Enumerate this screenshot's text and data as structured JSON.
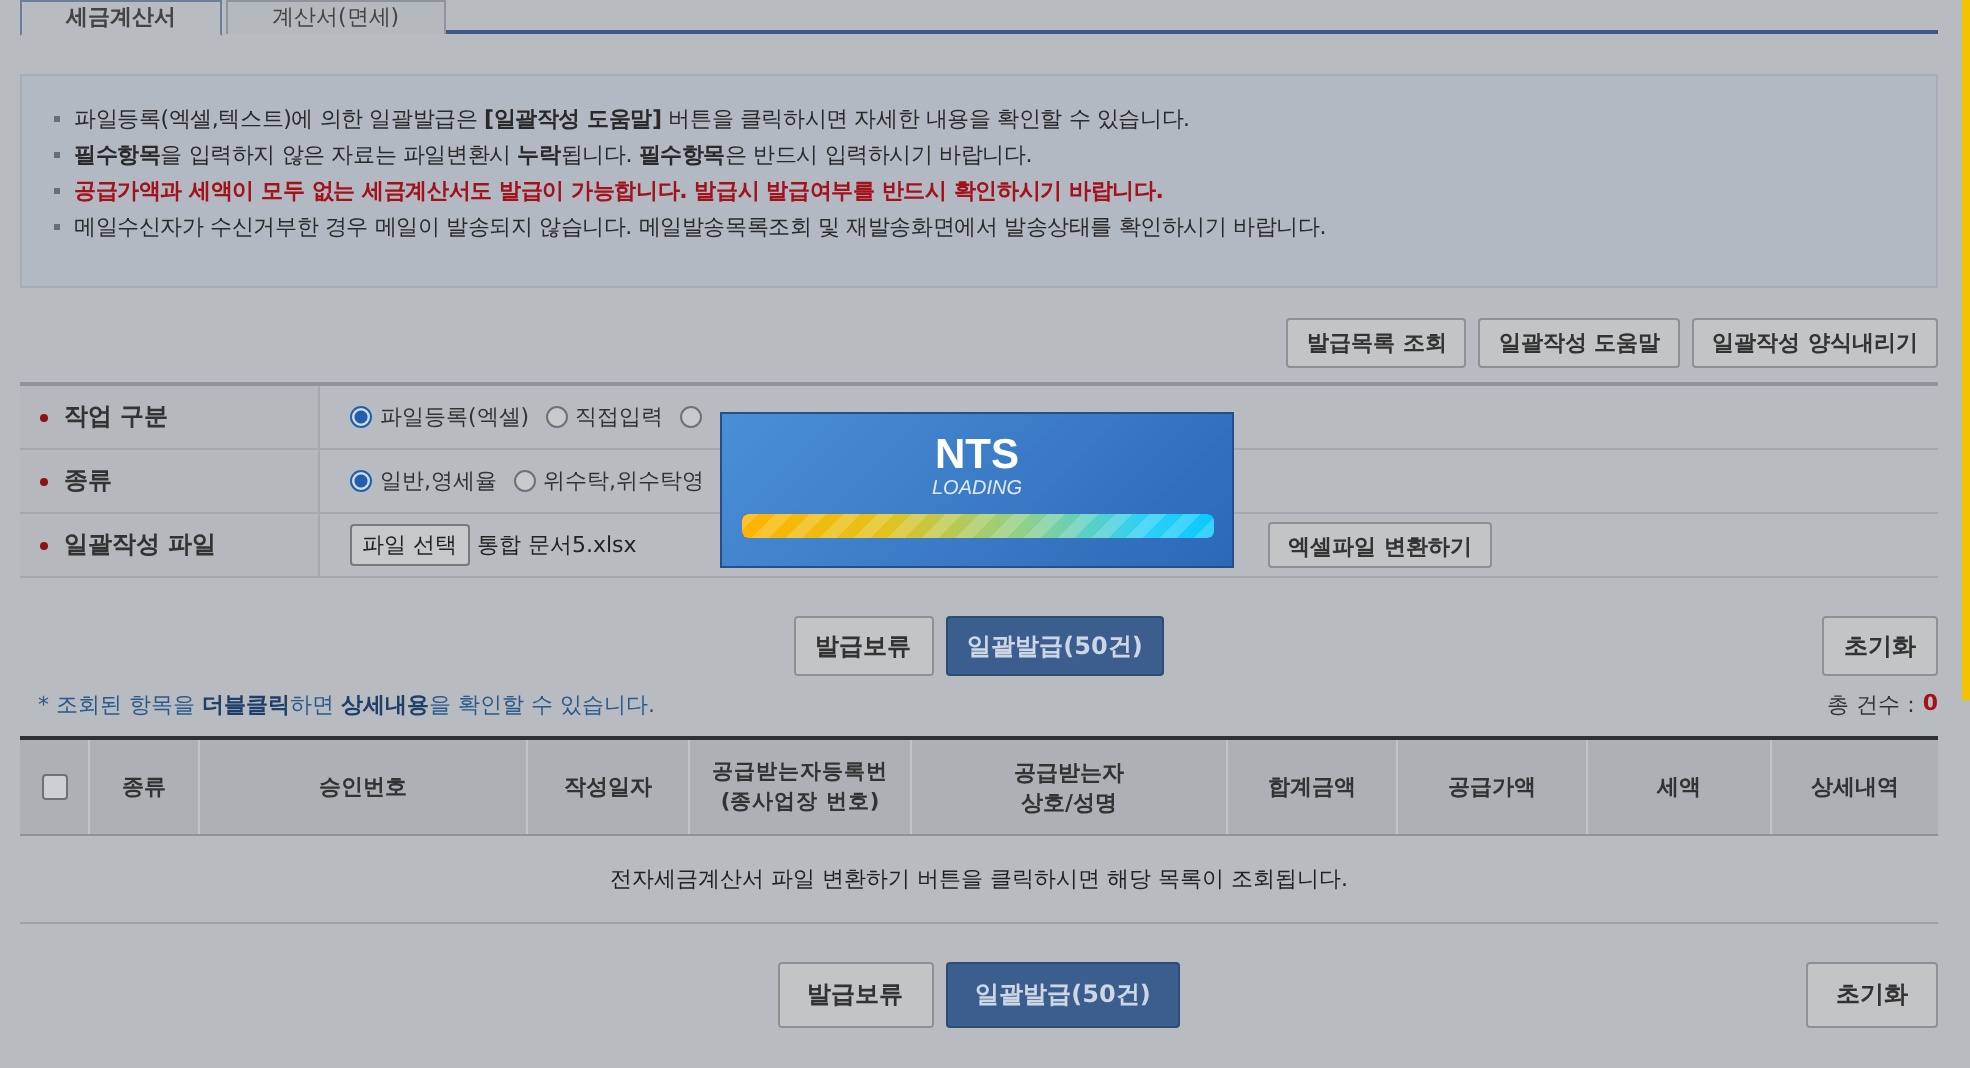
{
  "tabs": [
    {
      "label": "세금계산서",
      "selected": true
    },
    {
      "label": "계산서(면세)",
      "selected": false
    }
  ],
  "notices": [
    {
      "kind": "normal",
      "text": "파일등록(엑셀,텍스트)에 의한 일괄발급은 **[일괄작성 도움말]** 버튼을 클릭하시면 자세한 내용을 확인할 수 있습니다."
    },
    {
      "kind": "normal",
      "text": "**필수항목**을 입력하지 않은 자료는 파일변환시 **누락**됩니다. **필수항목**은 반드시 입력하시기 바랍니다."
    },
    {
      "kind": "alert",
      "text": "공급가액과 세액이 모두 없는 세금계산서도 발급이 가능합니다. 발급시 발급여부를 반드시 확인하시기 바랍니다."
    },
    {
      "kind": "normal",
      "text": "메일수신자가 수신거부한 경우 메일이 발송되지 않습니다. 메일발송목록조회 및 재발송화면에서 발송상태를 확인하시기 바랍니다."
    }
  ],
  "top_buttons": [
    "발급목록 조회",
    "일괄작성 도움말",
    "일괄작성 양식내리기"
  ],
  "form": [
    {
      "kind": "radio",
      "label": "작업 구분",
      "required": true,
      "options": [
        {
          "label": "파일등록(엑셀)",
          "selected": true
        },
        {
          "label": "직접입력",
          "selected": false
        },
        {
          "selected": false
        }
      ]
    },
    {
      "kind": "radio",
      "label": "종류",
      "required": true,
      "options": [
        {
          "label": "일반,영세율",
          "selected": true
        },
        {
          "label": "위수탁,위수탁영",
          "selected": false
        }
      ]
    },
    {
      "kind": "file",
      "label": "일괄작성 파일",
      "required": true,
      "button": "파일 선택",
      "filename": "통합 문서5.xlsx",
      "action": "엑셀파일 변환하기"
    }
  ],
  "action_buttons": [
    {
      "kind": "plain",
      "label": "발급보류"
    },
    {
      "kind": "primary",
      "label": "일괄발급(50건)"
    }
  ],
  "reset_button": "초기화",
  "hint": "* 조회된 항목을 **더블클릭**하면 **상세내용**을 확인할 수 있습니다.",
  "total_label": "총 건수 :",
  "total": "0",
  "table": {
    "select_all": {
      "checked": false
    },
    "columns": [
      "종류",
      "승인번호",
      "작성일자",
      "공급받는자등록번\n(종사업장 번호)",
      "공급받는자\n상호/성명",
      "합계금액",
      "공급가액",
      "세액",
      "상세내역"
    ],
    "empty_message": "전자세금계산서 파일 변환하기 버튼을 클릭하시면 해당 목록이 조회됩니다."
  },
  "bottom_buttons": [
    {
      "kind": "plain",
      "label": "발급보류"
    },
    {
      "kind": "primary",
      "label": "일괄발급(50건)"
    }
  ],
  "bottom_reset_button": "초기화",
  "loading": {
    "title": "NTS",
    "subtitle": "LOADING",
    "level": 1
  }
}
